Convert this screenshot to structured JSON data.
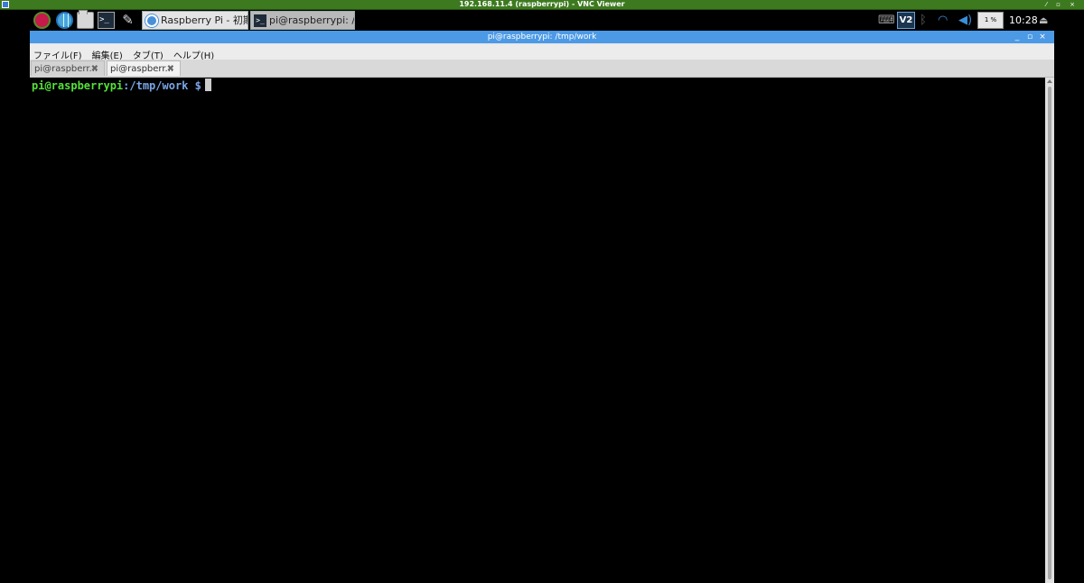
{
  "vnc": {
    "title": "192.168.11.4 (raspberrypi) - VNC Viewer",
    "controls": "⁄ ▫ ×"
  },
  "taskbar": {
    "launchers": [
      {
        "icon": "raspberry-pi-menu-icon"
      },
      {
        "icon": "web-browser-icon"
      },
      {
        "icon": "file-manager-icon"
      },
      {
        "icon": "terminal-icon",
        "glyph": ">_"
      },
      {
        "icon": "pen-icon",
        "glyph": "✎"
      }
    ],
    "tasks": [
      {
        "label": "Raspberry Pi - 初期設..."
      },
      {
        "label": "pi@raspberrypi: /tmp..."
      }
    ],
    "tray": {
      "keyboard_glyph": "⌨",
      "vnc_glyph": "V2",
      "bluetooth_glyph": "ᛒ",
      "wifi_glyph": "◠",
      "volume_glyph": "◀)",
      "cpu_usage": "1 %",
      "clock": "10:28",
      "eject_glyph": "⏏"
    }
  },
  "window": {
    "title": "pi@raspberrypi: /tmp/work",
    "controls": {
      "minimize": "_",
      "maximize": "▫",
      "close": "×"
    },
    "menu": [
      "ファイル(F)",
      "編集(E)",
      "タブ(T)",
      "ヘルプ(H)"
    ],
    "tabs": [
      {
        "label": "pi@raspberr...",
        "close": "✖"
      },
      {
        "label": "pi@raspberr...",
        "close": "✖"
      }
    ],
    "terminal": {
      "user_host": "pi@raspberrypi",
      "path": ":/tmp/work",
      "dollar": " $"
    }
  },
  "colors": {
    "vnc_bar": "#3d7a1f",
    "title_bar": "#4c9ae6",
    "prompt_user": "#55e13a",
    "prompt_path": "#7aa6e8"
  }
}
